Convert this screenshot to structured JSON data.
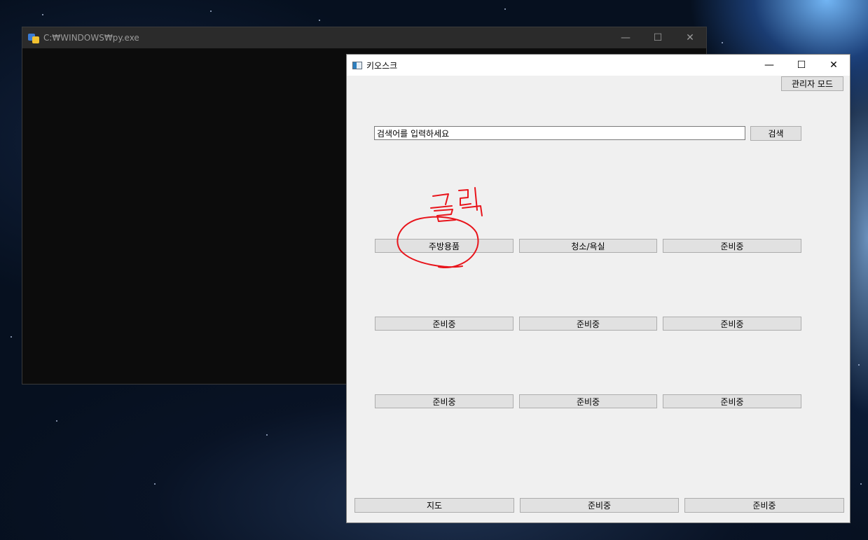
{
  "console_window": {
    "title": "C:₩WINDOWS₩py.exe",
    "minimize": "—",
    "maximize": "☐",
    "close": "✕"
  },
  "kiosk_window": {
    "title": "키오스크",
    "minimize": "—",
    "maximize": "☐",
    "close": "✕",
    "admin_button": "관리자 모드",
    "search": {
      "value": "검색어를 입력하세요",
      "button": "검색"
    },
    "category_rows": [
      [
        "주방용품",
        "청소/욕실",
        "준비중"
      ],
      [
        "준비중",
        "준비중",
        "준비중"
      ],
      [
        "준비중",
        "준비중",
        "준비중"
      ]
    ],
    "bottom_buttons": [
      "지도",
      "준비중",
      "준비중"
    ]
  },
  "annotation": {
    "text": "클릭",
    "color": "#e8141b"
  }
}
